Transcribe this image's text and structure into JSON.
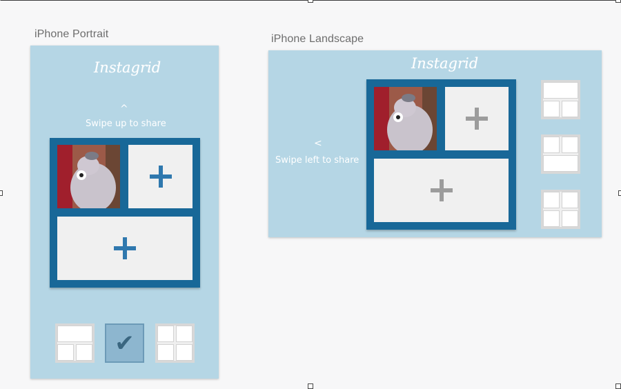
{
  "colors": {
    "canvas": "#f7f7f8",
    "artboard": "#b5d6e5",
    "grid_frame": "#186898",
    "cell": "#f0f0f0",
    "plus_portrait": "#2f78ae",
    "plus_landscape": "#9c9c9c",
    "selected_layout": "#8db6cf"
  },
  "portrait": {
    "label": "iPhone Portrait",
    "brand": "Instagrid",
    "swipe_arrow": "^",
    "swipe_text": "Swipe up to share",
    "cells": [
      "photo",
      "plus",
      "plus"
    ],
    "layouts": [
      {
        "name": "layout-1",
        "icon": "layout-one-top-two-bottom-icon",
        "selected": false
      },
      {
        "name": "layout-2",
        "icon": "checkmark-icon",
        "selected": true
      },
      {
        "name": "layout-3",
        "icon": "layout-four-grid-icon",
        "selected": false
      }
    ]
  },
  "landscape": {
    "label": "iPhone Landscape",
    "brand": "Instagrid",
    "swipe_arrow": "<",
    "swipe_text": "Swipe left to share",
    "cells": [
      "photo",
      "plus",
      "plus"
    ],
    "layouts": [
      {
        "name": "layout-1",
        "icon": "layout-one-top-two-bottom-icon",
        "selected": false
      },
      {
        "name": "layout-2",
        "icon": "layout-two-top-one-bottom-icon",
        "selected": false
      },
      {
        "name": "layout-3",
        "icon": "layout-four-grid-icon",
        "selected": false
      }
    ]
  }
}
